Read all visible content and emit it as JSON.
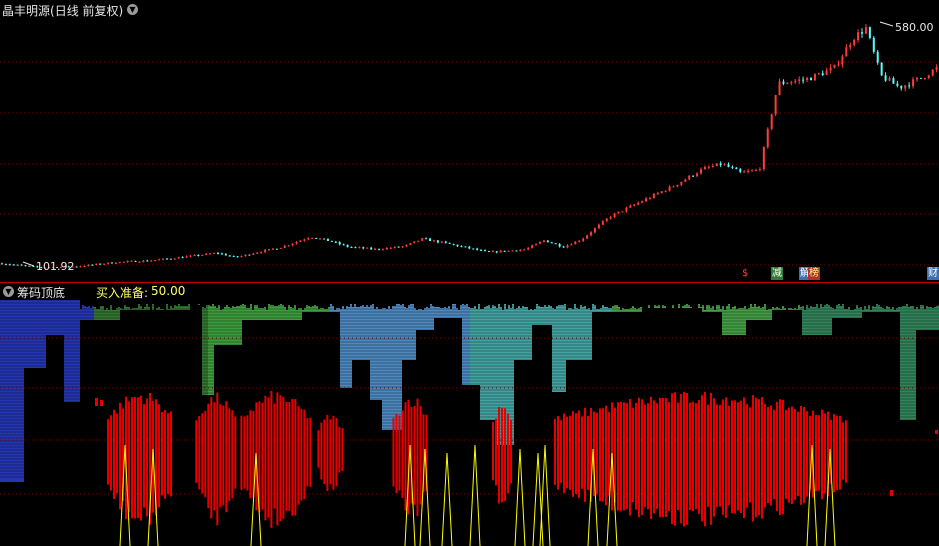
{
  "header": {
    "title": "晶丰明源",
    "title_suffix": "(日线 前复权)"
  },
  "event_markers": [
    {
      "text": "$",
      "color": "#ff4040",
      "bg": "transparent"
    },
    {
      "text": "减",
      "color": "#ffffff",
      "bg": "#2e7d32"
    },
    {
      "text": "解",
      "color": "#ffffff",
      "bg": "#3b6fb0"
    },
    {
      "text": "榜",
      "color": "#ffff66",
      "bg": "#b03030"
    },
    {
      "text": "财",
      "color": "#ffffff",
      "bg": "#3b6fb0"
    }
  ],
  "indicator": {
    "name": "筹码顶底",
    "label": "买入准备:",
    "value": "50.00"
  },
  "colors": {
    "up": "#ff3b3b",
    "down": "#54ffff",
    "grid": "#7a0000",
    "separator": "#c00000",
    "bar_red": "#e80000",
    "line_yellow": "#ffff00",
    "chip_blue": "#3050d0",
    "chip_green": "#40c040"
  },
  "chart_data": [
    {
      "type": "candlestick",
      "title": "晶丰明源 (日线 前复权)",
      "x": "trading days (unlabeled)",
      "ylim": [
        95,
        600
      ],
      "annotations": [
        {
          "text": "580.00",
          "kind": "period_high",
          "value": 580.0
        },
        {
          "text": "101.92",
          "kind": "period_low",
          "value": 101.92
        }
      ],
      "close_trend": [
        [
          0,
          112
        ],
        [
          20,
          104
        ],
        [
          40,
          106
        ],
        [
          60,
          114
        ],
        [
          80,
          118
        ],
        [
          100,
          126
        ],
        [
          115,
          133
        ],
        [
          125,
          124
        ],
        [
          135,
          133
        ],
        [
          150,
          145
        ],
        [
          165,
          165
        ],
        [
          175,
          157
        ],
        [
          185,
          145
        ],
        [
          200,
          140
        ],
        [
          215,
          146
        ],
        [
          225,
          161
        ],
        [
          240,
          150
        ],
        [
          260,
          134
        ],
        [
          280,
          140
        ],
        [
          290,
          158
        ],
        [
          300,
          145
        ],
        [
          310,
          160
        ],
        [
          325,
          205
        ],
        [
          340,
          232
        ],
        [
          360,
          268
        ],
        [
          375,
          300
        ],
        [
          385,
          310
        ],
        [
          395,
          292
        ],
        [
          405,
          298
        ],
        [
          415,
          470
        ],
        [
          430,
          478
        ],
        [
          445,
          500
        ],
        [
          455,
          560
        ],
        [
          462,
          580
        ],
        [
          470,
          485
        ],
        [
          480,
          462
        ],
        [
          490,
          478
        ],
        [
          500,
          500
        ]
      ]
    },
    {
      "type": "bar",
      "title": "筹码顶底",
      "series": [
        {
          "name": "买入准备",
          "last_value": 50.0,
          "red_bar_segments": [
            {
              "start": 57,
              "end": 92,
              "peak": 78
            },
            {
              "start": 104,
              "end": 125,
              "peak": 74
            },
            {
              "start": 128,
              "end": 165,
              "peak": 77
            },
            {
              "start": 169,
              "end": 182,
              "peak": 45
            },
            {
              "start": 209,
              "end": 228,
              "peak": 72
            },
            {
              "start": 262,
              "end": 272,
              "peak": 65
            },
            {
              "start": 295,
              "end": 450,
              "peak": 76
            }
          ]
        }
      ]
    }
  ]
}
